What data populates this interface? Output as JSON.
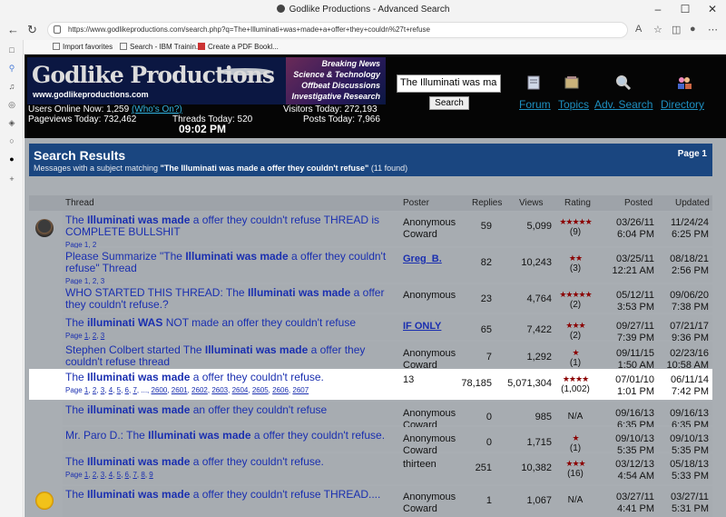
{
  "window": {
    "title": "Godlike Productions - Advanced Search"
  },
  "browser": {
    "url": "https://www.godlikeproductions.com/search.php?q=The+Illuminati+was+made+a+offer+they+couldn%27t+refuse",
    "bookmarks": [
      "Import favorites",
      "Search - IBM Trainin...",
      "Create a PDF Bookl..."
    ]
  },
  "site": {
    "logo": "Godlike Productions",
    "logo_url": "www.godlikeproductions.com",
    "taglines": [
      "Breaking News",
      "Science & Technology",
      "Offbeat Discussions",
      "Investigative Research"
    ],
    "stats": {
      "users_online_label": "Users Online Now:",
      "users_online": "1,259",
      "whos_on": "(Who's On?)",
      "visitors_today_label": "Visitors Today:",
      "visitors_today": "272,193",
      "pageviews_today_label": "Pageviews Today:",
      "pageviews_today": "732,462",
      "threads_today_label": "Threads Today:",
      "threads_today": "520",
      "posts_today_label": "Posts Today:",
      "posts_today": "7,966",
      "time": "09:02 PM"
    },
    "search": {
      "value": "The Illuminati was ma",
      "button": "Search"
    },
    "nav": [
      "Forum",
      "Topics",
      "Adv. Search",
      "Directory"
    ]
  },
  "results": {
    "title": "Search Results",
    "subtitle_prefix": "Messages with a subject matching ",
    "query": "\"The Illuminati was made a offer they couldn't refuse\"",
    "found": " (11 found)",
    "page": "Page 1",
    "columns": [
      "Thread",
      "Poster",
      "Replies",
      "Views",
      "Rating",
      "Posted",
      "Updated"
    ],
    "rows": [
      {
        "t1": "The ",
        "tb": "Illuminati was made",
        "t2": " a offer they couldn't refuse THREAD is COMPLETE BULLSHIT",
        "pages_label": "Page",
        "pages": [
          "1",
          "2"
        ],
        "poster": "Anonymous Coward",
        "replies": "59",
        "views": "5,099",
        "stars": "★★★★★",
        "count": "(9)",
        "posted": "03/26/11",
        "posted_time": "6:04 PM",
        "updated": "11/24/24",
        "updated_time": "6:25 PM"
      },
      {
        "t1": "Please Summarize \"The ",
        "tb": "Illuminati was made",
        "t2": " a offer they couldn't refuse\" Thread",
        "pages_label": "Page",
        "pages": [
          "1",
          "2",
          "3"
        ],
        "poster": "Greg_B.",
        "replies": "82",
        "views": "10,243",
        "stars": "★★",
        "count": "(3)",
        "posted": "03/25/11",
        "posted_time": "12:21 AM",
        "updated": "08/18/21",
        "updated_time": "2:56 PM"
      },
      {
        "t1": "WHO STARTED THIS THREAD: The ",
        "tb": "Illuminati was made",
        "t2": " a offer they couldn't refuse.?",
        "pages_label": "",
        "pages": [],
        "poster": "Anonymous",
        "replies": "23",
        "views": "4,764",
        "stars": "★★★★★",
        "count": "(2)",
        "posted": "05/12/11",
        "posted_time": "3:53 PM",
        "updated": "09/06/20",
        "updated_time": "7:38 PM"
      },
      {
        "t1": "The ",
        "tb": "illuminati WAS",
        "t2": " NOT made an offer they couldn't refuse",
        "pages_label": "Page",
        "pages": [
          "1",
          "2",
          "3"
        ],
        "poster": "IF ONLY",
        "replies": "65",
        "views": "7,422",
        "stars": "★★★",
        "count": "(2)",
        "posted": "09/27/11",
        "posted_time": "7:39 PM",
        "updated": "07/21/17",
        "updated_time": "9:36 PM"
      },
      {
        "t1": "Stephen Colbert started The ",
        "tb": "Illuminati was made",
        "t2": " a offer they couldn't refuse thread",
        "pages_label": "",
        "pages": [],
        "poster": "Anonymous Coward",
        "replies": "7",
        "views": "1,292",
        "stars": "★",
        "count": "(1)",
        "posted": "09/11/15",
        "posted_time": "1:50 AM",
        "updated": "02/23/16",
        "updated_time": "10:58 AM"
      },
      {
        "t1": "The ",
        "tb": "Illuminati was made",
        "t2": " a offer they couldn't refuse.",
        "pages_label": "Page",
        "pages": [
          "1",
          "2",
          "3",
          "4",
          "5",
          "6",
          "7",
          "...",
          "2600",
          "2601",
          "2602",
          "2603",
          "2604",
          "2605",
          "2606",
          "2607"
        ],
        "poster": "13",
        "replies": "78,185",
        "views": "5,071,304",
        "stars": "★★★★",
        "count": "(1,002)",
        "posted": "07/01/10",
        "posted_time": "1:01 PM",
        "updated": "06/11/14",
        "updated_time": "7:42 PM"
      },
      {
        "t1": "The ",
        "tb": "illuminati was made",
        "t2": " an offer they couldn't refuse",
        "pages_label": "",
        "pages": [],
        "poster": "Anonymous Coward",
        "replies": "0",
        "views": "985",
        "stars": "",
        "count": "N/A",
        "posted": "09/16/13",
        "posted_time": "6:35 PM",
        "updated": "09/16/13",
        "updated_time": "6:35 PM"
      },
      {
        "t1": "Mr. Paro D.: The ",
        "tb": "Illuminati was made",
        "t2": " a offer they couldn't refuse.",
        "pages_label": "",
        "pages": [],
        "poster": "Anonymous Coward",
        "replies": "0",
        "views": "1,715",
        "stars": "★",
        "count": "(1)",
        "posted": "09/10/13",
        "posted_time": "5:35 PM",
        "updated": "09/10/13",
        "updated_time": "5:35 PM"
      },
      {
        "t1": "The ",
        "tb": "Illuminati was made",
        "t2": " a offer they couldn't refuse.",
        "pages_label": "Page",
        "pages": [
          "1",
          "2",
          "3",
          "4",
          "5",
          "6",
          "7",
          "8",
          "9"
        ],
        "poster": "thirteen",
        "replies": "251",
        "views": "10,382",
        "stars": "★★★",
        "count": "(16)",
        "posted": "03/12/13",
        "posted_time": "4:54 AM",
        "updated": "05/18/13",
        "updated_time": "5:33 PM"
      },
      {
        "t1": "The ",
        "tb": "Illuminati was made",
        "t2": " a offer they couldn't refuse THREAD....",
        "pages_label": "",
        "pages": [],
        "poster": "Anonymous Coward",
        "replies": "1",
        "views": "1,067",
        "stars": "",
        "count": "N/A",
        "posted": "03/27/11",
        "posted_time": "4:41 PM",
        "updated": "03/27/11",
        "updated_time": "5:31 PM"
      }
    ]
  }
}
